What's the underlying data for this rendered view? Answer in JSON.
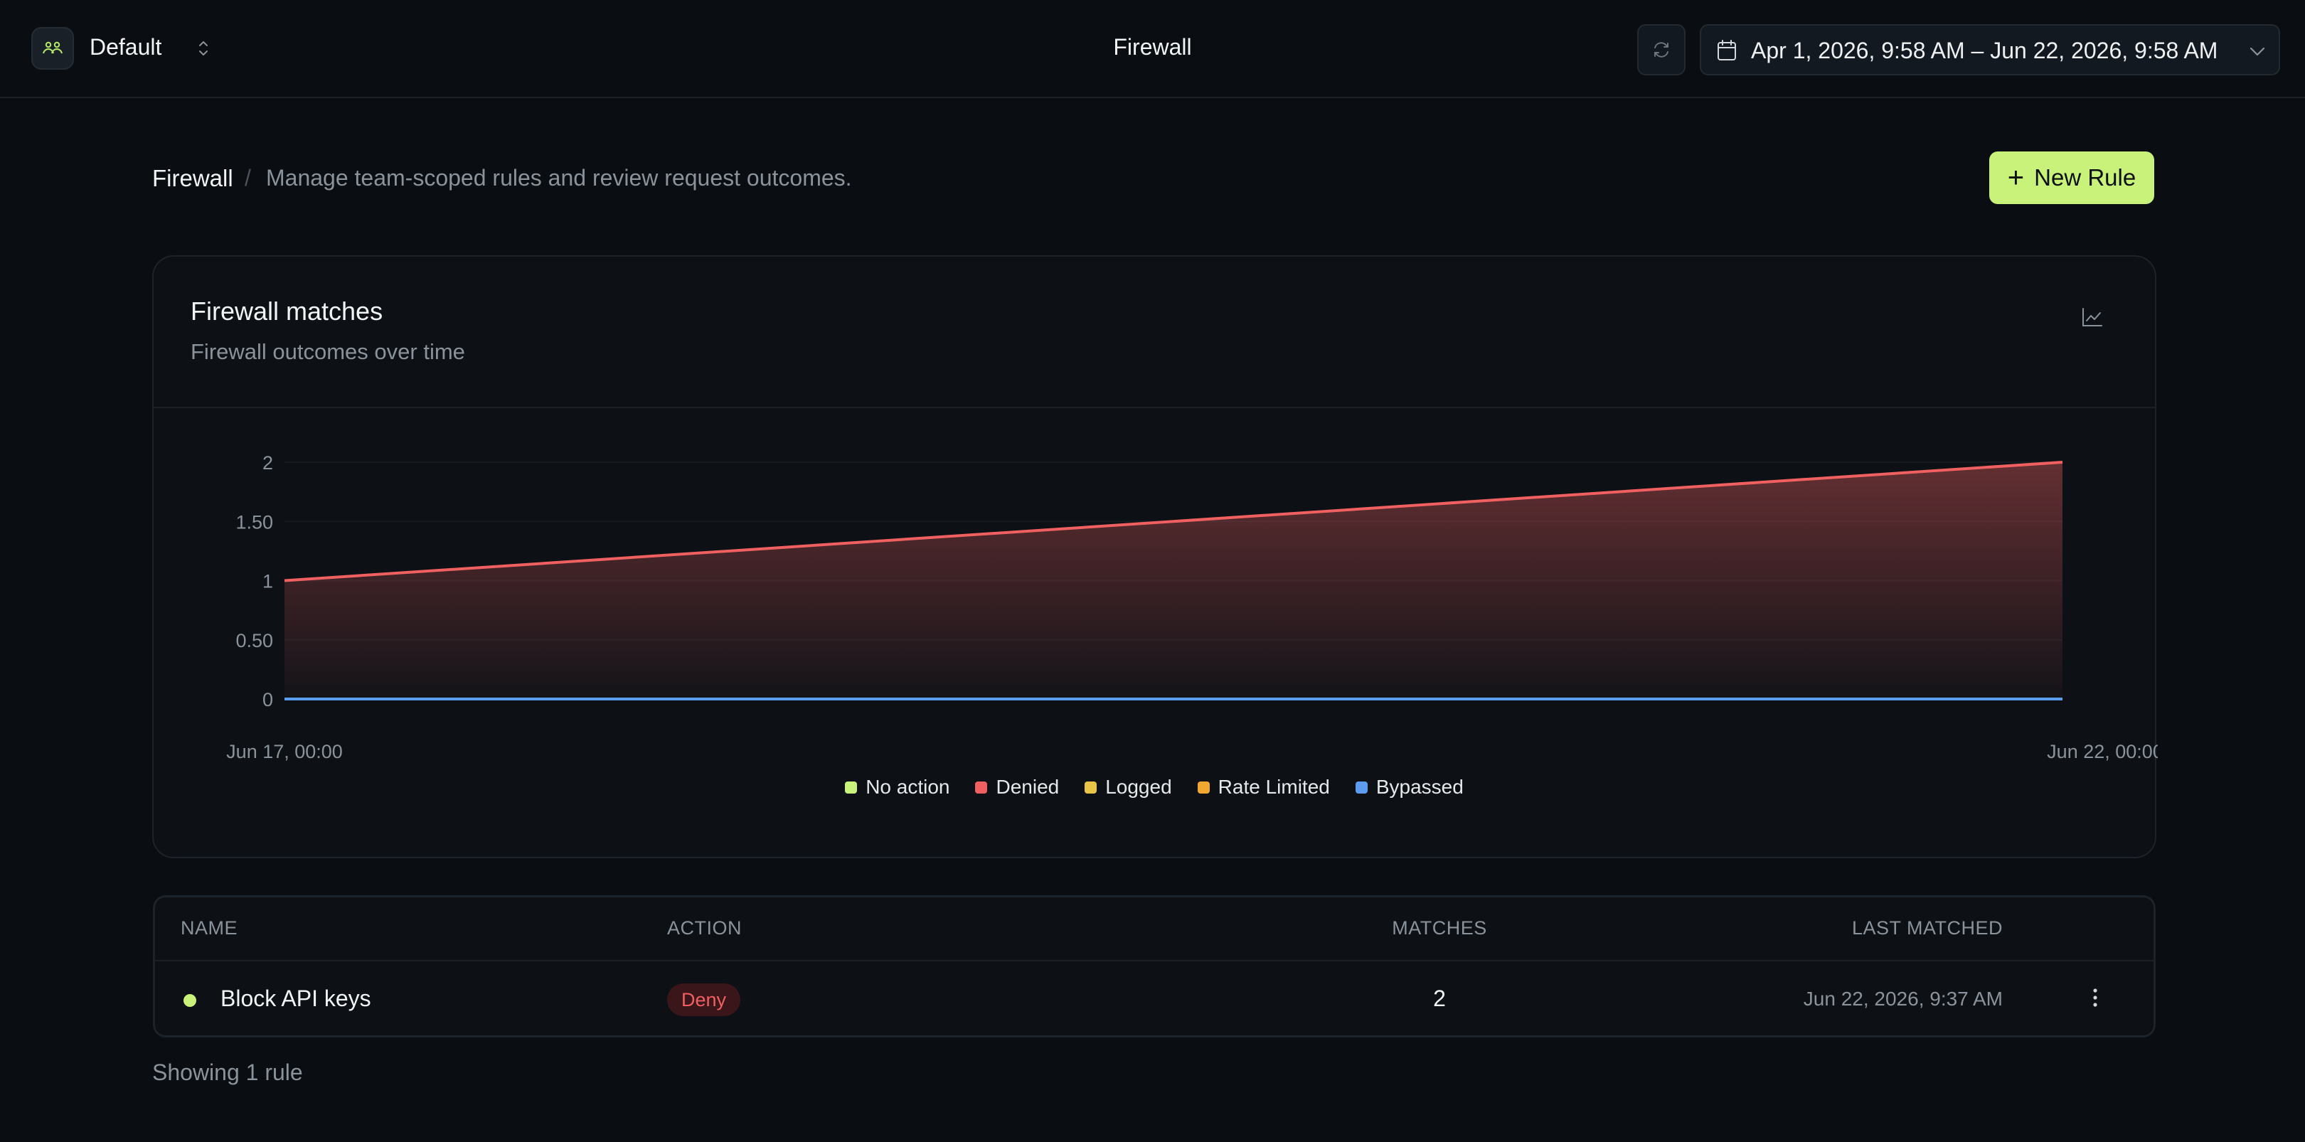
{
  "header": {
    "team_name": "Default",
    "title": "Firewall",
    "date_range": "Apr 1, 2026, 9:58 AM – Jun 22, 2026, 9:58 AM"
  },
  "page": {
    "breadcrumb_title": "Firewall",
    "breadcrumb_separator": "/",
    "description": "Manage team-scoped rules and review request outcomes.",
    "new_rule_label": "New Rule"
  },
  "chart_card": {
    "title": "Firewall matches",
    "subtitle": "Firewall outcomes over time"
  },
  "chart_data": {
    "type": "area",
    "x": [
      "Jun 17, 00:00",
      "Jun 22, 00:00"
    ],
    "ylim": [
      0,
      2
    ],
    "y_ticks": [
      "0",
      "0.50",
      "1",
      "1.50",
      "2"
    ],
    "grid": true,
    "legend_position": "bottom",
    "series": [
      {
        "name": "No action",
        "color": "#c8f27a",
        "values": [
          0,
          0
        ]
      },
      {
        "name": "Denied",
        "color": "#f06060",
        "values": [
          1,
          2
        ]
      },
      {
        "name": "Logged",
        "color": "#e8c547",
        "values": [
          0,
          0
        ]
      },
      {
        "name": "Rate Limited",
        "color": "#f0a830",
        "values": [
          0,
          0
        ]
      },
      {
        "name": "Bypassed",
        "color": "#5b9cf0",
        "values": [
          0,
          0
        ]
      }
    ]
  },
  "table": {
    "columns": [
      "NAME",
      "ACTION",
      "MATCHES",
      "LAST MATCHED"
    ],
    "rows": [
      {
        "name": "Block API keys",
        "action": "Deny",
        "matches": "2",
        "last_matched": "Jun 22, 2026, 9:37 AM",
        "status_color": "#c8f27a"
      }
    ],
    "footer": "Showing 1 rule"
  }
}
